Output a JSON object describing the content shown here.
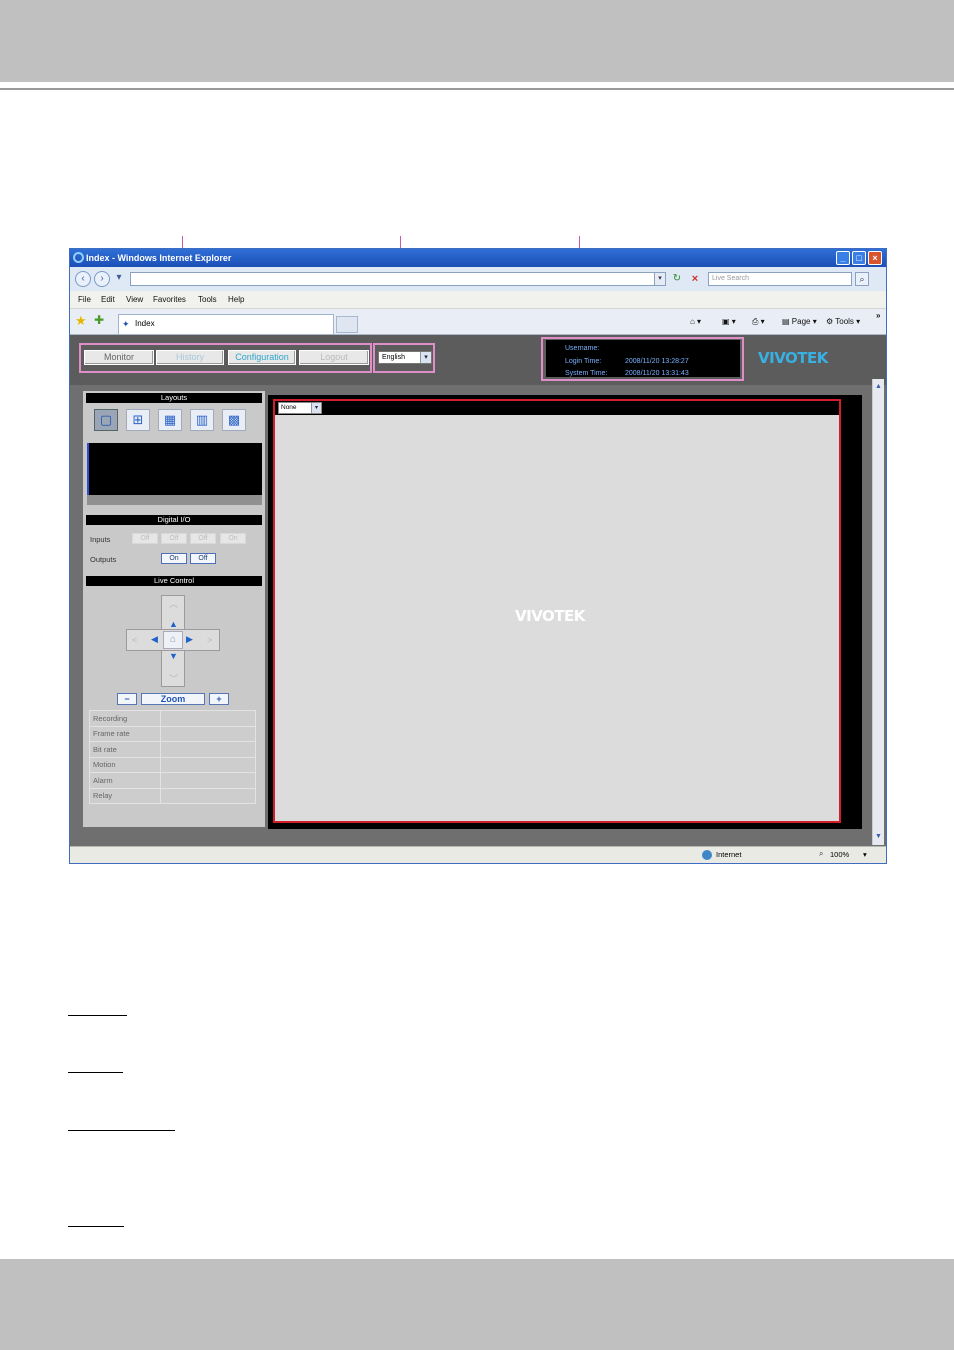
{
  "browser": {
    "title": "Index - Windows Internet Explorer",
    "search_placeholder": "Live Search",
    "menu": [
      "File",
      "Edit",
      "View",
      "Favorites",
      "Tools",
      "Help"
    ],
    "tab_label": "Index",
    "commands": {
      "page": "Page",
      "tools": "Tools",
      "chevron": "»"
    },
    "status": {
      "zone": "Internet",
      "zoom": "100%"
    }
  },
  "app": {
    "nav": {
      "monitor": "Monitor",
      "history": "History",
      "configuration": "Configuration",
      "logout": "Logout"
    },
    "language": "English",
    "info": {
      "username_label": "Username:",
      "username_value": "",
      "login_label": "Login Time:",
      "login_value": "2008/11/20 13:28:27",
      "system_label": "System Time:",
      "system_value": "2008/11/20 13:31:43"
    },
    "brand": "VIVOTEK",
    "layouts_title": "Layouts",
    "digital_io": {
      "title": "Digital I/O",
      "inputs_label": "Inputs",
      "inputs": [
        "Off",
        "Off",
        "Off",
        "On"
      ],
      "outputs_label": "Outputs",
      "outputs": [
        "On",
        "Off"
      ]
    },
    "live_control": {
      "title": "Live Control",
      "zoom_label": "Zoom",
      "zoom_minus": "−",
      "zoom_plus": "+"
    },
    "status_rows": [
      "Recording",
      "Frame rate",
      "Bit rate",
      "Motion",
      "Alarm",
      "Relay"
    ],
    "video": {
      "source": "None",
      "watermark": "VIVOTEK"
    }
  },
  "colors": {
    "callout": "#c95aa8",
    "highlight": "#de8fc8",
    "video_border": "#d01e2a",
    "info_text": "#7ab2ff",
    "brand_blue": "#39b0e3"
  }
}
